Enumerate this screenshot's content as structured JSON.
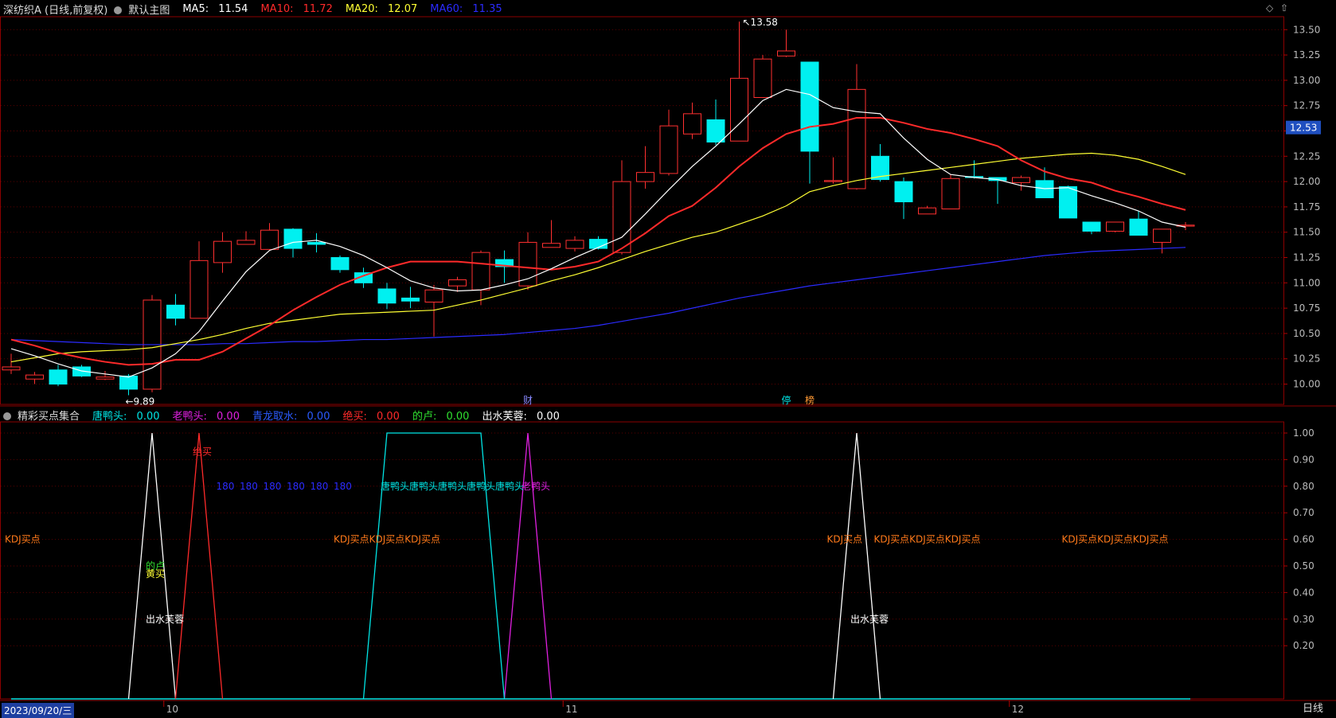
{
  "main_header": {
    "stock_title": "深纺织A (日线,前复权)",
    "template": "默认主图",
    "ma5": {
      "label": "MA5:",
      "value": "11.54",
      "color": "#ffffff"
    },
    "ma10": {
      "label": "MA10:",
      "value": "11.72",
      "color": "#ff2a2a"
    },
    "ma20": {
      "label": "MA20:",
      "value": "12.07",
      "color": "#ffff33"
    },
    "ma60": {
      "label": "MA60:",
      "value": "11.35",
      "color": "#2b2bff"
    }
  },
  "sub_header": {
    "indicator": "精彩买点集合",
    "items": [
      {
        "label": "唐鸭头:",
        "value": "0.00",
        "color": "#00e5e5"
      },
      {
        "label": "老鸭头:",
        "value": "0.00",
        "color": "#e020e0"
      },
      {
        "label": "青龙取水:",
        "value": "0.00",
        "color": "#2b5bff"
      },
      {
        "label": "绝买:",
        "value": "0.00",
        "color": "#ff2a2a"
      },
      {
        "label": "的卢:",
        "value": "0.00",
        "color": "#30e030"
      },
      {
        "label": "出水芙蓉:",
        "value": "0.00",
        "color": "#ffffff"
      }
    ]
  },
  "price_axis": {
    "ticks": [
      "13.50",
      "13.25",
      "13.00",
      "12.75",
      "12.50",
      "12.25",
      "12.00",
      "11.75",
      "11.50",
      "11.25",
      "11.00",
      "10.75",
      "10.50",
      "10.25",
      "10.00"
    ],
    "current_price": "12.53"
  },
  "sub_axis": {
    "ticks": [
      "1.00",
      "0.90",
      "0.80",
      "0.70",
      "0.60",
      "0.50",
      "0.40",
      "0.30",
      "0.20"
    ]
  },
  "chart_data": {
    "type": "candlestick",
    "ylim": [
      9.8,
      13.62
    ],
    "candles": [
      {
        "o": 10.14,
        "h": 10.3,
        "l": 10.1,
        "c": 10.17
      },
      {
        "o": 10.05,
        "h": 10.12,
        "l": 10.0,
        "c": 10.09
      },
      {
        "o": 10.14,
        "h": 10.19,
        "l": 9.98,
        "c": 10.0
      },
      {
        "o": 10.17,
        "h": 10.19,
        "l": 10.07,
        "c": 10.08
      },
      {
        "o": 10.05,
        "h": 10.13,
        "l": 10.04,
        "c": 10.07
      },
      {
        "o": 10.08,
        "h": 10.1,
        "l": 9.89,
        "c": 9.95
      },
      {
        "o": 9.95,
        "h": 10.88,
        "l": 9.92,
        "c": 10.83
      },
      {
        "o": 10.78,
        "h": 10.89,
        "l": 10.58,
        "c": 10.65
      },
      {
        "o": 10.65,
        "h": 11.41,
        "l": 10.65,
        "c": 11.22
      },
      {
        "o": 11.2,
        "h": 11.5,
        "l": 11.1,
        "c": 11.41
      },
      {
        "o": 11.38,
        "h": 11.51,
        "l": 11.38,
        "c": 11.42
      },
      {
        "o": 11.33,
        "h": 11.59,
        "l": 11.32,
        "c": 11.52
      },
      {
        "o": 11.53,
        "h": 11.54,
        "l": 11.25,
        "c": 11.34
      },
      {
        "o": 11.4,
        "h": 11.49,
        "l": 11.3,
        "c": 11.38
      },
      {
        "o": 11.25,
        "h": 11.27,
        "l": 11.1,
        "c": 11.13
      },
      {
        "o": 11.1,
        "h": 11.15,
        "l": 10.95,
        "c": 11.0
      },
      {
        "o": 10.94,
        "h": 11.0,
        "l": 10.74,
        "c": 10.8
      },
      {
        "o": 10.85,
        "h": 10.96,
        "l": 10.75,
        "c": 10.82
      },
      {
        "o": 10.81,
        "h": 10.98,
        "l": 10.47,
        "c": 10.93
      },
      {
        "o": 10.97,
        "h": 11.06,
        "l": 10.91,
        "c": 11.03
      },
      {
        "o": 10.93,
        "h": 11.32,
        "l": 10.78,
        "c": 11.3
      },
      {
        "o": 11.23,
        "h": 11.32,
        "l": 11.0,
        "c": 11.16
      },
      {
        "o": 10.97,
        "h": 11.5,
        "l": 10.93,
        "c": 11.4
      },
      {
        "o": 11.35,
        "h": 11.62,
        "l": 11.35,
        "c": 11.39
      },
      {
        "o": 11.34,
        "h": 11.46,
        "l": 11.31,
        "c": 11.42
      },
      {
        "o": 11.43,
        "h": 11.46,
        "l": 11.33,
        "c": 11.34
      },
      {
        "o": 11.3,
        "h": 12.21,
        "l": 11.28,
        "c": 12.0
      },
      {
        "o": 12.0,
        "h": 12.35,
        "l": 11.93,
        "c": 12.09
      },
      {
        "o": 12.08,
        "h": 12.71,
        "l": 12.06,
        "c": 12.55
      },
      {
        "o": 12.47,
        "h": 12.78,
        "l": 12.42,
        "c": 12.67
      },
      {
        "o": 12.61,
        "h": 12.81,
        "l": 12.36,
        "c": 12.39
      },
      {
        "o": 12.4,
        "h": 13.58,
        "l": 12.4,
        "c": 13.02
      },
      {
        "o": 12.83,
        "h": 13.25,
        "l": 12.83,
        "c": 13.21
      },
      {
        "o": 13.24,
        "h": 13.5,
        "l": 13.23,
        "c": 13.29
      },
      {
        "o": 13.18,
        "h": 13.18,
        "l": 11.98,
        "c": 12.3
      },
      {
        "o": 12.0,
        "h": 12.24,
        "l": 11.98,
        "c": 12.01
      },
      {
        "o": 11.93,
        "h": 13.16,
        "l": 11.92,
        "c": 12.91
      },
      {
        "o": 12.25,
        "h": 12.37,
        "l": 12.0,
        "c": 12.02
      },
      {
        "o": 12.0,
        "h": 12.04,
        "l": 11.63,
        "c": 11.8
      },
      {
        "o": 11.68,
        "h": 11.76,
        "l": 11.68,
        "c": 11.74
      },
      {
        "o": 11.73,
        "h": 12.07,
        "l": 11.73,
        "c": 12.03
      },
      {
        "o": 12.05,
        "h": 12.21,
        "l": 12.03,
        "c": 12.04
      },
      {
        "o": 12.04,
        "h": 12.04,
        "l": 11.78,
        "c": 12.01
      },
      {
        "o": 11.99,
        "h": 12.06,
        "l": 11.91,
        "c": 12.04
      },
      {
        "o": 12.01,
        "h": 12.14,
        "l": 11.84,
        "c": 11.84
      },
      {
        "o": 11.95,
        "h": 11.96,
        "l": 11.64,
        "c": 11.64
      },
      {
        "o": 11.6,
        "h": 11.6,
        "l": 11.48,
        "c": 11.51
      },
      {
        "o": 11.51,
        "h": 11.6,
        "l": 11.5,
        "c": 11.6
      },
      {
        "o": 11.63,
        "h": 11.71,
        "l": 11.47,
        "c": 11.47
      },
      {
        "o": 11.4,
        "h": 11.53,
        "l": 11.29,
        "c": 11.53
      },
      {
        "o": 11.56,
        "h": 11.6,
        "l": 11.52,
        "c": 11.57
      }
    ],
    "ma5": [
      10.35,
      10.28,
      10.2,
      10.13,
      10.1,
      10.07,
      10.16,
      10.3,
      10.52,
      10.82,
      11.11,
      11.32,
      11.4,
      11.42,
      11.36,
      11.27,
      11.15,
      11.02,
      10.95,
      10.92,
      10.93,
      10.98,
      11.04,
      11.14,
      11.25,
      11.35,
      11.45,
      11.68,
      11.92,
      12.15,
      12.35,
      12.57,
      12.8,
      12.91,
      12.86,
      12.73,
      12.69,
      12.67,
      12.43,
      12.22,
      12.07,
      12.04,
      12.02,
      11.96,
      11.93,
      11.94,
      11.86,
      11.79,
      11.71,
      11.6,
      11.55
    ],
    "ma10": [
      10.44,
      10.38,
      10.31,
      10.26,
      10.22,
      10.19,
      10.2,
      10.24,
      10.24,
      10.32,
      10.45,
      10.58,
      10.73,
      10.86,
      10.98,
      11.07,
      11.15,
      11.21,
      11.21,
      11.21,
      11.19,
      11.17,
      11.15,
      11.13,
      11.16,
      11.21,
      11.34,
      11.49,
      11.66,
      11.76,
      11.94,
      12.15,
      12.33,
      12.47,
      12.54,
      12.57,
      12.63,
      12.63,
      12.58,
      12.52,
      12.48,
      12.42,
      12.35,
      12.21,
      12.1,
      12.03,
      11.99,
      11.91,
      11.85,
      11.78,
      11.72
    ],
    "ma20": [
      10.22,
      10.26,
      10.3,
      10.32,
      10.33,
      10.34,
      10.36,
      10.4,
      10.44,
      10.49,
      10.55,
      10.6,
      10.63,
      10.66,
      10.69,
      10.7,
      10.71,
      10.72,
      10.73,
      10.78,
      10.83,
      10.89,
      10.95,
      11.02,
      11.08,
      11.15,
      11.23,
      11.31,
      11.38,
      11.45,
      11.5,
      11.58,
      11.66,
      11.76,
      11.9,
      11.96,
      12.01,
      12.05,
      12.08,
      12.11,
      12.14,
      12.17,
      12.2,
      12.23,
      12.25,
      12.27,
      12.28,
      12.26,
      12.22,
      12.15,
      12.07
    ],
    "ma60": [
      10.44,
      10.43,
      10.42,
      10.41,
      10.4,
      10.39,
      10.39,
      10.39,
      10.39,
      10.4,
      10.4,
      10.41,
      10.42,
      10.42,
      10.43,
      10.44,
      10.44,
      10.45,
      10.46,
      10.47,
      10.48,
      10.49,
      10.51,
      10.53,
      10.55,
      10.58,
      10.62,
      10.66,
      10.7,
      10.75,
      10.8,
      10.85,
      10.89,
      10.93,
      10.97,
      11.0,
      11.03,
      11.06,
      11.09,
      11.12,
      11.15,
      11.18,
      11.21,
      11.24,
      11.27,
      11.29,
      11.31,
      11.32,
      11.33,
      11.34,
      11.35
    ],
    "high_label": "13.58",
    "low_label": "9.89",
    "event_markers": [
      {
        "bar": 22,
        "text": "财",
        "color": "#8888ff"
      },
      {
        "bar": 33,
        "text": "停",
        "color": "#00e5e5"
      },
      {
        "bar": 34,
        "text": "榜",
        "color": "#ff9933"
      }
    ],
    "signals": {
      "chushui": [
        {
          "from": 5,
          "peak": 6,
          "to": 7
        },
        {
          "from": 35,
          "peak": 36,
          "to": 37
        }
      ],
      "juemai": [
        {
          "from": 7,
          "peak": 8,
          "to": 9
        }
      ],
      "tangyatou": [
        {
          "from": 15,
          "top_from": 16,
          "top_to": 20,
          "to": 21
        }
      ],
      "laoyatou": [
        {
          "from": 21,
          "peak": 22,
          "to": 23
        }
      ]
    },
    "sub_texts": [
      {
        "text": "KDJ买点",
        "bar": 0,
        "val": 0.6,
        "color": "#ff7a1a"
      },
      {
        "text": "KDJ买点KDJ买点KDJ买点",
        "bar": 14,
        "val": 0.6,
        "color": "#ff7a1a"
      },
      {
        "text": "KDJ买点",
        "bar": 35,
        "val": 0.6,
        "color": "#ff7a1a"
      },
      {
        "text": "KDJ买点KDJ买点KDJ买点",
        "bar": 37,
        "val": 0.6,
        "color": "#ff7a1a"
      },
      {
        "text": "KDJ买点KDJ买点KDJ买点",
        "bar": 45,
        "val": 0.6,
        "color": "#ff7a1a"
      },
      {
        "text": "180",
        "bar": 9,
        "val": 0.8,
        "color": "#2b2bff"
      },
      {
        "text": "180",
        "bar": 10,
        "val": 0.8,
        "color": "#2b2bff"
      },
      {
        "text": "180",
        "bar": 11,
        "val": 0.8,
        "color": "#2b2bff"
      },
      {
        "text": "180",
        "bar": 12,
        "val": 0.8,
        "color": "#2b2bff"
      },
      {
        "text": "180",
        "bar": 13,
        "val": 0.8,
        "color": "#2b2bff"
      },
      {
        "text": "180",
        "bar": 14,
        "val": 0.8,
        "color": "#2b2bff"
      },
      {
        "text": "唐鸭头唐鸭头唐鸭头唐鸭头唐鸭头",
        "bar": 16,
        "val": 0.8,
        "color": "#00e5e5"
      },
      {
        "text": "老鸭头",
        "bar": 22,
        "val": 0.8,
        "color": "#e020e0"
      },
      {
        "text": "绝买",
        "bar": 8,
        "val": 0.93,
        "color": "#ff2a2a"
      },
      {
        "text": "的卢",
        "bar": 6,
        "val": 0.5,
        "color": "#30e030"
      },
      {
        "text": "黄买",
        "bar": 6,
        "val": 0.47,
        "color": "#ffff33"
      },
      {
        "text": "出水芙蓉",
        "bar": 6,
        "val": 0.3,
        "color": "#ffffff"
      },
      {
        "text": "出水芙蓉",
        "bar": 36,
        "val": 0.3,
        "color": "#ffffff"
      }
    ],
    "x_ticks": [
      {
        "bar": 7,
        "text": "10"
      },
      {
        "bar": 24,
        "text": "11"
      },
      {
        "bar": 43,
        "text": "12"
      }
    ]
  },
  "bottom_bar": {
    "date": "2023/09/20/三",
    "period": "日线"
  },
  "corner_icons": [
    "diamond-icon",
    "scroll-up-icon"
  ]
}
